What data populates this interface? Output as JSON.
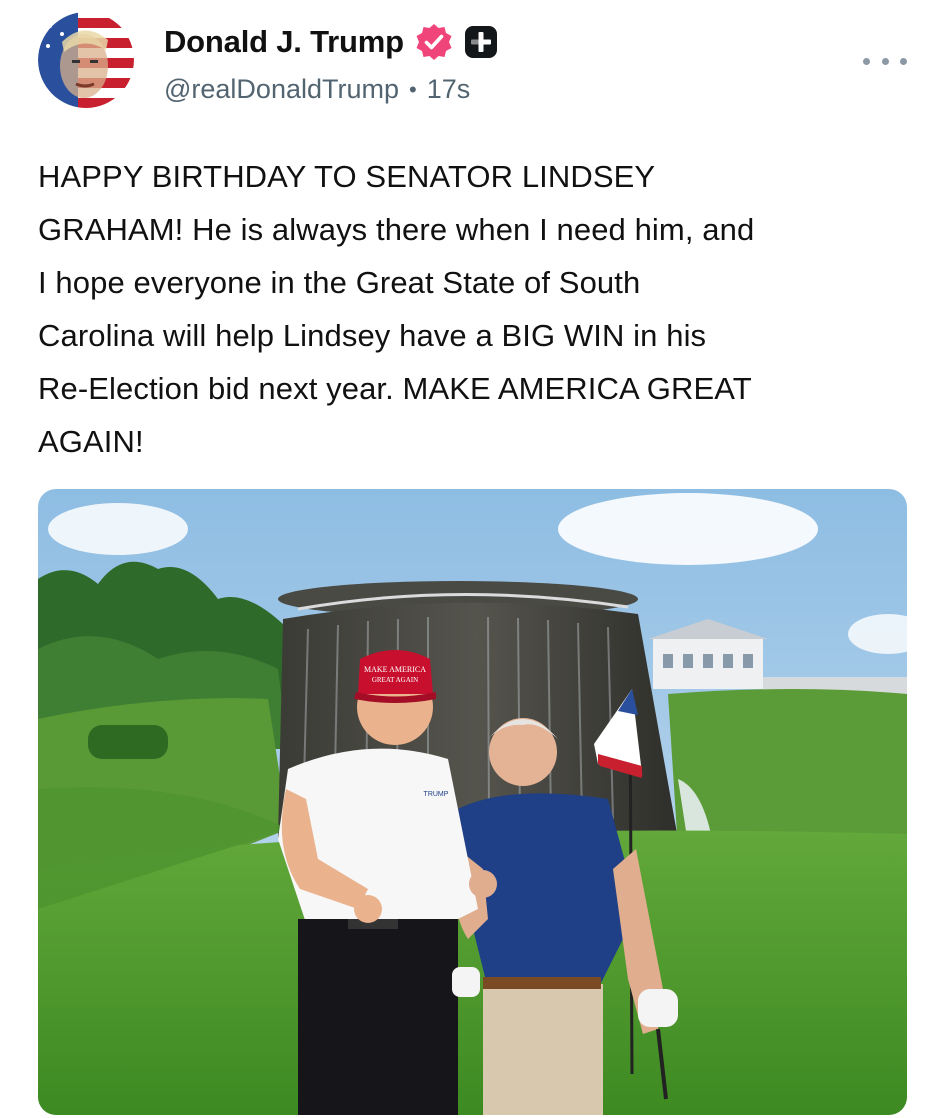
{
  "post": {
    "author": {
      "display_name": "Donald J. Trump",
      "handle": "@realDonaldTrump",
      "verified_icon": "verified-badge-icon",
      "extra_icon": "plus-badge-icon"
    },
    "separator": "•",
    "timestamp": "17s",
    "more_icon": "more-options-icon",
    "text": "HAPPY BIRTHDAY TO SENATOR LINDSEY\nGRAHAM! He is always there when I need him, and\nI hope everyone in the Great State of South\nCarolina will help Lindsey have a BIG WIN in his\nRe-Election bid next year. MAKE AMERICA GREAT\nAGAIN!",
    "image": {
      "hat_text": [
        "MAKE AMERICA",
        "GREAT AGAIN"
      ],
      "shirt_logo_text": "TRUMP"
    }
  },
  "colors": {
    "verified_pink": "#f0457a",
    "handle_gray": "#536471",
    "hat_red": "#c8102e",
    "grass_green": "#4f9e2a",
    "sky_blue": "#9fc6e6"
  }
}
